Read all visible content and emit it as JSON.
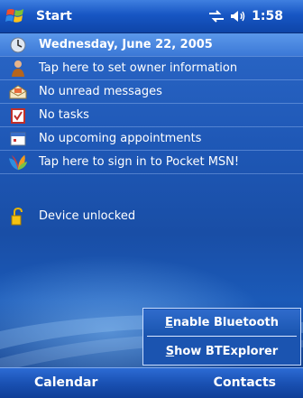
{
  "titlebar": {
    "title": "Start",
    "time": "1:58"
  },
  "today": {
    "items": [
      {
        "icon": "clock-icon",
        "label": "Wednesday, June 22, 2005"
      },
      {
        "icon": "owner-icon",
        "label": "Tap here to set owner information"
      },
      {
        "icon": "mail-icon",
        "label": "No unread messages"
      },
      {
        "icon": "tasks-icon",
        "label": "No tasks"
      },
      {
        "icon": "calendar-icon",
        "label": "No upcoming appointments"
      },
      {
        "icon": "msn-butterfly-icon",
        "label": "Tap here to sign in to Pocket MSN!"
      },
      {
        "icon": "lock-icon",
        "label": "Device unlocked"
      }
    ]
  },
  "menu": {
    "items": [
      {
        "label": "Enable Bluetooth",
        "accel": "E"
      },
      {
        "label": "Show BTExplorer",
        "accel": "S"
      }
    ]
  },
  "softkeys": {
    "left": "Calendar",
    "right": "Contacts"
  },
  "colors": {
    "selection": "#3b78d6",
    "titlebar": "#1756c4",
    "desktop": "#1e57b5"
  }
}
